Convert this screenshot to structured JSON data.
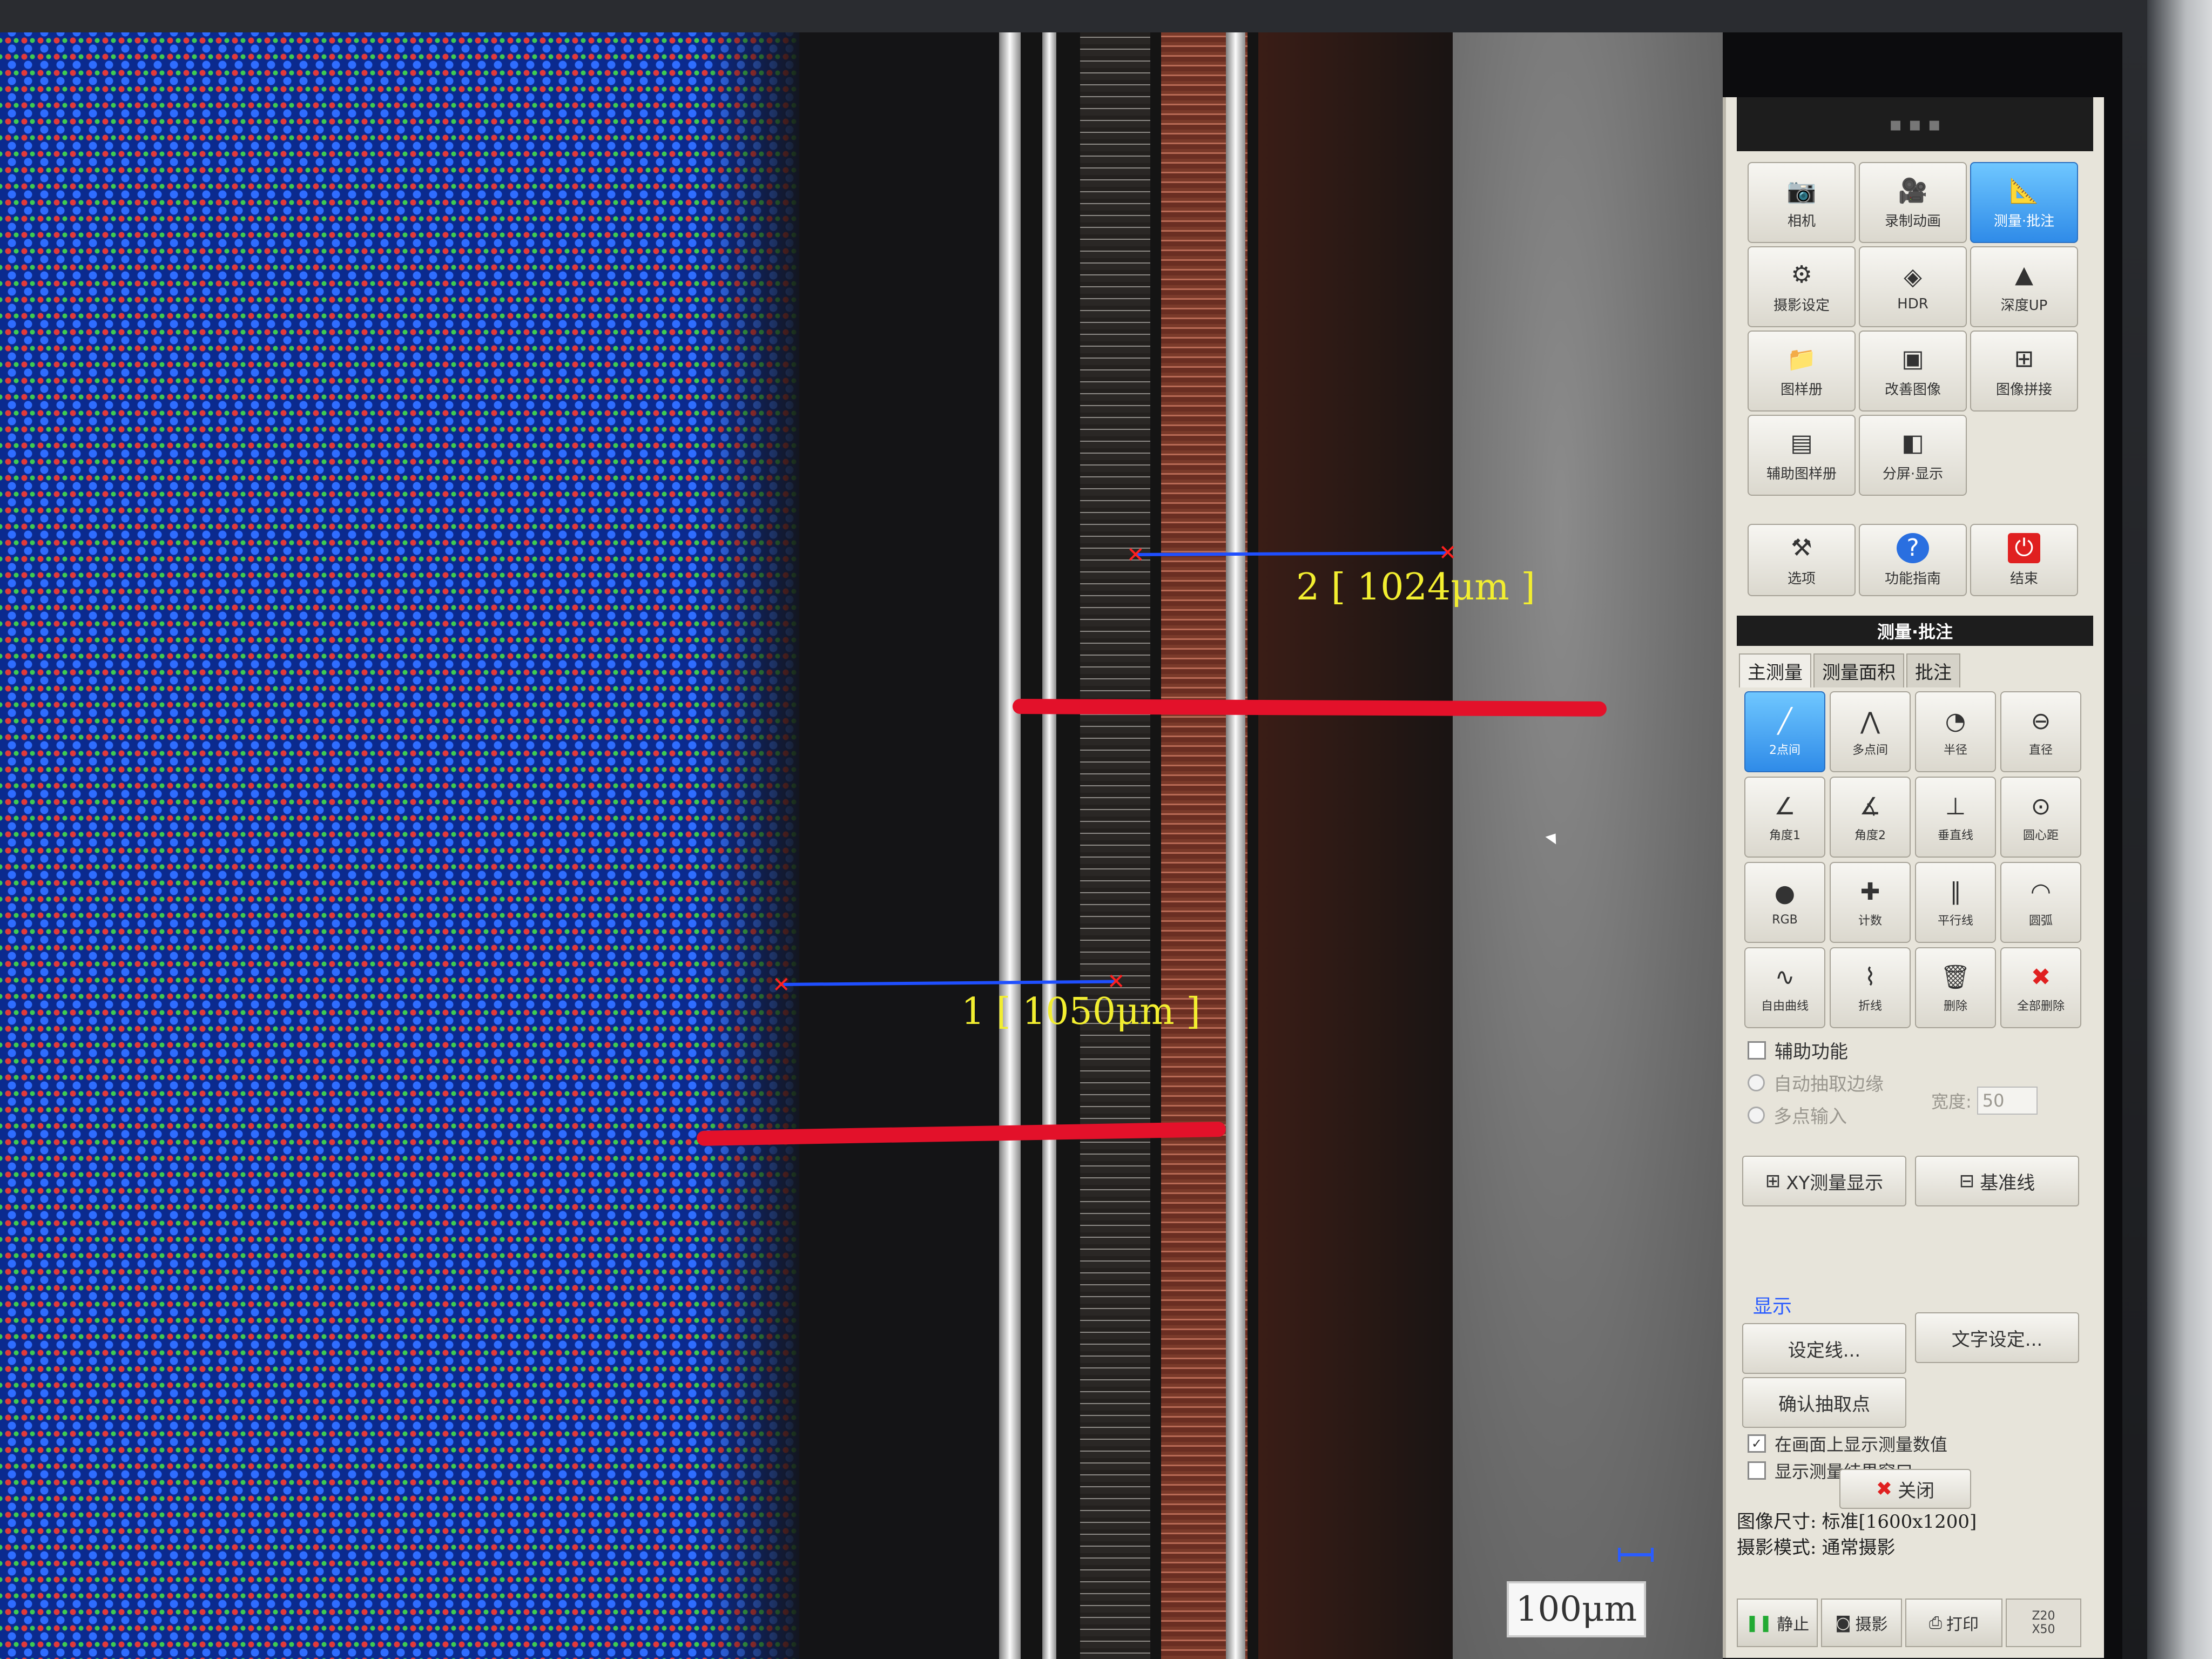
{
  "viewer": {
    "measurements": [
      {
        "label": "1 [ 1050μm ]"
      },
      {
        "label": "2 [ 1024μm ]"
      }
    ],
    "scale_bar": "100μm"
  },
  "panel": {
    "tools": [
      {
        "label": "相机",
        "icon": "camera-icon",
        "active": false
      },
      {
        "label": "录制动画",
        "icon": "video-camera-icon",
        "active": false
      },
      {
        "label": "测量·批注",
        "icon": "measure-annotate-icon",
        "active": true
      },
      {
        "label": "摄影设定",
        "icon": "capture-settings-icon",
        "active": false
      },
      {
        "label": "HDR",
        "icon": "hdr-icon",
        "active": false
      },
      {
        "label": "深度UP",
        "icon": "depth-up-icon",
        "active": false
      },
      {
        "label": "图样册",
        "icon": "album-icon",
        "active": false
      },
      {
        "label": "改善图像",
        "icon": "improve-image-icon",
        "active": false
      },
      {
        "label": "图像拼接",
        "icon": "image-stitch-icon",
        "active": false
      },
      {
        "label": "辅助图样册",
        "icon": "aux-album-icon",
        "active": false
      },
      {
        "label": "分屏·显示",
        "icon": "split-screen-icon",
        "active": false
      }
    ],
    "system_buttons": [
      {
        "label": "选项",
        "icon": "tools-icon"
      },
      {
        "label": "功能指南",
        "icon": "help-icon"
      },
      {
        "label": "结束",
        "icon": "power-icon"
      }
    ],
    "section_title": "测量·批注",
    "tabs": [
      "主测量",
      "测量面积",
      "批注"
    ],
    "measure_tools": [
      {
        "label": "2点间",
        "icon": "two-point-icon",
        "active": true
      },
      {
        "label": "多点间",
        "icon": "multi-point-icon",
        "active": false
      },
      {
        "label": "半径",
        "icon": "radius-icon",
        "active": false
      },
      {
        "label": "直径",
        "icon": "diameter-icon",
        "active": false
      },
      {
        "label": "角度1",
        "icon": "angle1-icon",
        "active": false
      },
      {
        "label": "角度2",
        "icon": "angle2-icon",
        "active": false
      },
      {
        "label": "垂直线",
        "icon": "perpendicular-icon",
        "active": false
      },
      {
        "label": "圆心距",
        "icon": "center-distance-icon",
        "active": false
      },
      {
        "label": "RGB",
        "icon": "rgb-icon",
        "active": false
      },
      {
        "label": "计数",
        "icon": "count-icon",
        "active": false
      },
      {
        "label": "平行线",
        "icon": "parallel-icon",
        "active": false
      },
      {
        "label": "圆弧",
        "icon": "arc-icon",
        "active": false
      },
      {
        "label": "自由曲线",
        "icon": "free-curve-icon",
        "active": false
      },
      {
        "label": "折线",
        "icon": "polyline-icon",
        "active": false
      },
      {
        "label": "删除",
        "icon": "trash-icon",
        "active": false
      },
      {
        "label": "全部删除",
        "icon": "delete-all-icon",
        "active": false
      }
    ],
    "assist": {
      "title": "辅助功能",
      "auto_edge": "自动抽取边缘",
      "multi_point": "多点输入",
      "width_label": "宽度:",
      "width_value": "50",
      "xy_button": "XY测量显示",
      "baseline_button": "基准线"
    },
    "display": {
      "title": "显示",
      "set_line": "设定线...",
      "text_settings": "文字设定...",
      "confirm_points": "确认抽取点",
      "show_values": "在画面上显示测量数值",
      "show_values_checked": true,
      "show_results": "显示测量结果窗口",
      "show_results_checked": false,
      "close": "关闭"
    },
    "status": {
      "image_size_label": "图像尺寸:",
      "image_size_value": "标准[1600x1200]",
      "capture_mode_label": "摄影模式:",
      "capture_mode_value": "通常摄影"
    },
    "bottom": {
      "still": "静止",
      "capture": "摄影",
      "print": "打印",
      "zoom_line1": "Z20",
      "zoom_line2": "X50"
    }
  }
}
